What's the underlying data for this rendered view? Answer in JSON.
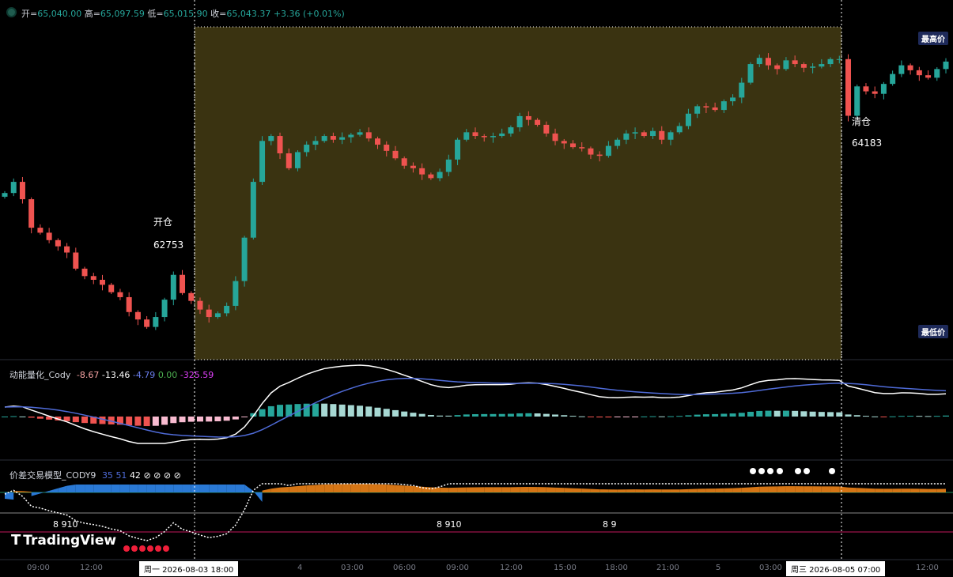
{
  "main_legend": {
    "open_label": "开=",
    "open": "65,040.00",
    "high_label": "高=",
    "high": "65,097.59",
    "low_label": "低=",
    "low": "65,015.90",
    "close_label": "收=",
    "close": "65,043.37",
    "change": "+3.36 (+0.01%)"
  },
  "price_scale": {
    "highest": "最高价",
    "lowest": "最低价"
  },
  "trade": {
    "open_label": "开仓",
    "open_price": "62753",
    "close_label": "清仓",
    "close_price": "64183"
  },
  "indicator1": {
    "name": "动能量化_Cody",
    "v1": "-8.67",
    "v2": "-13.46",
    "v3": "-4.79",
    "v4": "0.00",
    "v5": "-325.59"
  },
  "indicator2": {
    "name": "价差交易模型_CODY9",
    "v1": "35",
    "v2": "51",
    "v3": "42",
    "na": "⊘",
    "label_a": "8 910",
    "label_b": "8 910",
    "label_c": "8 9"
  },
  "logo": {
    "text": "TradingView"
  },
  "time_axis": {
    "ticks": [
      "09:00",
      "12:00",
      "4",
      "03:00",
      "06:00",
      "09:00",
      "12:00",
      "15:00",
      "18:00",
      "21:00",
      "5",
      "03:00",
      "12:00"
    ],
    "crosshair_left": "周一 2026-08-03   18:00",
    "crosshair_right": "周三 2026-08-05   07:00"
  },
  "colors": {
    "up": "#26a69a",
    "down": "#ef5350",
    "highlight": "#3a3311",
    "macd_line": "#ffffff",
    "signal_line": "#4f6bd8",
    "orange_fill": "#e07b16",
    "blue_fill": "#2c7fe0"
  },
  "chart_data": [
    {
      "type": "candlestick",
      "title": "",
      "ohlc_last": {
        "open": 65040.0,
        "high": 65097.59,
        "low": 65015.9,
        "close": 65043.37
      },
      "closes": [
        63560,
        63650,
        63510,
        63280,
        63240,
        63180,
        63130,
        63080,
        62950,
        62890,
        62860,
        62820,
        62760,
        62720,
        62600,
        62540,
        62480,
        62560,
        62700,
        62900,
        62753,
        62690,
        62620,
        62560,
        62590,
        62650,
        62850,
        63200,
        63650,
        63980,
        64020,
        63880,
        63760,
        63890,
        63950,
        63980,
        64020,
        63990,
        64010,
        64030,
        64050,
        64000,
        63950,
        63900,
        63840,
        63780,
        63760,
        63710,
        63680,
        63730,
        63830,
        63990,
        64050,
        64020,
        64010,
        64020,
        64040,
        64090,
        64180,
        64150,
        64110,
        64040,
        63980,
        63960,
        63930,
        63920,
        63870,
        63860,
        63940,
        63990,
        64040,
        64050,
        64020,
        64060,
        63990,
        64050,
        64100,
        64200,
        64260,
        64250,
        64230,
        64300,
        64330,
        64450,
        64600,
        64650,
        64590,
        64560,
        64630,
        64600,
        64570,
        64580,
        64600,
        64640,
        64640,
        64183,
        64420,
        64380,
        64360,
        64440,
        64520,
        64590,
        64550,
        64510,
        64490,
        64560,
        64620
      ]
    },
    {
      "type": "line",
      "title": "动能量化_Cody",
      "series": [
        {
          "name": "",
          "values": [
            -8.67
          ]
        },
        {
          "name": "",
          "values": [
            -13.46
          ]
        },
        {
          "name": "",
          "values": [
            -4.79
          ]
        },
        {
          "name": "",
          "values": [
            0.0
          ]
        },
        {
          "name": "",
          "values": [
            -325.59
          ]
        }
      ]
    },
    {
      "type": "area",
      "title": "价差交易模型_CODY9",
      "series": [
        {
          "name": "",
          "values": [
            35
          ]
        },
        {
          "name": "",
          "values": [
            51
          ]
        },
        {
          "name": "",
          "values": [
            42
          ]
        }
      ]
    }
  ]
}
